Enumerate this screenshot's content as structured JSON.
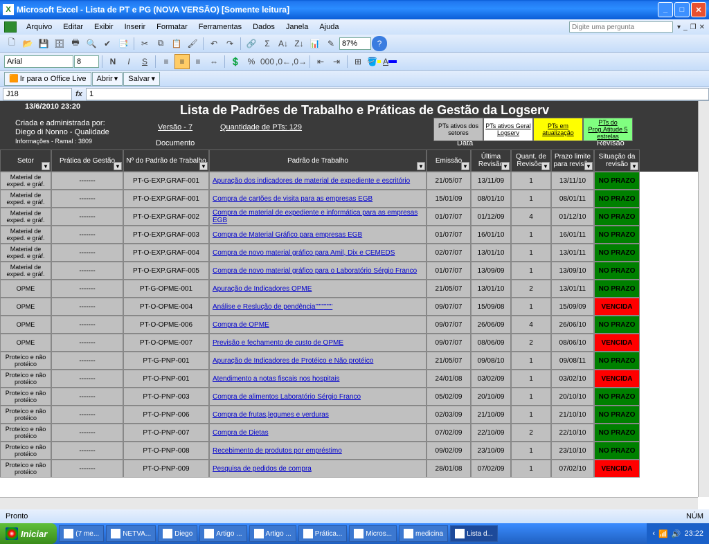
{
  "window": {
    "title": "Microsoft Excel - Lista de PT e PG (NOVA VERSÃO)  [Somente leitura]"
  },
  "menu": {
    "items": [
      "Arquivo",
      "Editar",
      "Exibir",
      "Inserir",
      "Formatar",
      "Ferramentas",
      "Dados",
      "Janela",
      "Ajuda"
    ],
    "ask_placeholder": "Digite uma pergunta"
  },
  "format": {
    "font_name": "Arial",
    "font_size": "8",
    "zoom": "87%"
  },
  "office_live": {
    "go": "Ir para o Office Live",
    "open": "Abrir",
    "save": "Salvar"
  },
  "formula": {
    "name_box": "J18",
    "fx": "fx",
    "value": "1"
  },
  "header": {
    "timestamp": "13/6/2010 23:20",
    "title": "Lista de Padrões de Trabalho e Práticas de Gestão da Logserv",
    "admin_line1": "Criada e administrada por:",
    "admin_line2": "Diego di Nonno  - Qualidade",
    "admin_line3": "Informações  - Ramal : 3809",
    "versao": "Versão - 7",
    "qtd_label": "Quantidade de PTs:",
    "qtd_value": "129",
    "documento": "Documento",
    "data": "Data",
    "revisao": "Revisão",
    "filters": {
      "setores": "PTs ativos dos setores",
      "geral": "PTs ativos Geral Logserv",
      "atual": "PTs em atualização",
      "atitude": "PTs do Prog.Atitude 5 estrelas"
    }
  },
  "columns": {
    "setor": "Setor",
    "pratica": "Prática de Gestão",
    "num": "Nº do Padrão de Trabalho",
    "padrao": "Padrão de Trabalho",
    "emissao": "Emissão",
    "ult_rev": "Última Revisão",
    "quant_rev": "Quant. de Revisões",
    "prazo": "Prazo limite para revisão",
    "sit": "Situação da revisão"
  },
  "rows": [
    {
      "setor": "Material de exped. e gráf.",
      "prat": "-------",
      "num": "PT-G-EXP.GRAF-001",
      "pad": "Apuração dos indicadores de material de expediente e escritório",
      "emis": "21/05/07",
      "urev": "13/11/09",
      "qrev": "1",
      "prazo": "13/11/10",
      "sit": "NO PRAZO",
      "ok": true
    },
    {
      "setor": "Material de exped. e gráf.",
      "prat": "-------",
      "num": "PT-O-EXP.GRAF-001",
      "pad": "Compra de cartões de visita para as empresas EGB",
      "emis": "15/01/09",
      "urev": "08/01/10",
      "qrev": "1",
      "prazo": "08/01/11",
      "sit": "NO PRAZO",
      "ok": true
    },
    {
      "setor": "Material de exped. e gráf.",
      "prat": "-------",
      "num": "PT-O-EXP.GRAF-002",
      "pad": "Compra de material de expediente e informática para as empresas EGB",
      "emis": "01/07/07",
      "urev": "01/12/09",
      "qrev": "4",
      "prazo": "01/12/10",
      "sit": "NO PRAZO",
      "ok": true
    },
    {
      "setor": "Material de exped. e gráf.",
      "prat": "-------",
      "num": "PT-O-EXP.GRAF-003",
      "pad": "Compra de Material Gráfico para empresas EGB",
      "emis": "01/07/07",
      "urev": "16/01/10",
      "qrev": "1",
      "prazo": "16/01/11",
      "sit": "NO PRAZO",
      "ok": true
    },
    {
      "setor": "Material de exped. e gráf.",
      "prat": "-------",
      "num": "PT-O-EXP.GRAF-004",
      "pad": "Compra de novo material gráfico para Amil, Dix e CEMEDS",
      "emis": "02/07/07",
      "urev": "13/01/10",
      "qrev": "1",
      "prazo": "13/01/11",
      "sit": "NO PRAZO",
      "ok": true
    },
    {
      "setor": "Material de exped. e gráf.",
      "prat": "-------",
      "num": "PT-O-EXP.GRAF-005",
      "pad": "Compra de novo material gráfico para o Laboratório Sérgio Franco",
      "emis": "01/07/07",
      "urev": "13/09/09",
      "qrev": "1",
      "prazo": "13/09/10",
      "sit": "NO PRAZO",
      "ok": true
    },
    {
      "setor": "OPME",
      "prat": "-------",
      "num": "PT-G-OPME-001",
      "pad": "Apuração de Indicadores OPME",
      "emis": "21/05/07",
      "urev": "13/01/10",
      "qrev": "2",
      "prazo": "13/01/11",
      "sit": "NO PRAZO",
      "ok": true
    },
    {
      "setor": "OPME",
      "prat": "-------",
      "num": "PT-O-OPME-004",
      "pad": "Análise e Reslução de pendência\"\"\"\"\"\"\"",
      "emis": "09/07/07",
      "urev": "15/09/08",
      "qrev": "1",
      "prazo": "15/09/09",
      "sit": "VENCIDA",
      "ok": false
    },
    {
      "setor": "OPME",
      "prat": "-------",
      "num": "PT-O-OPME-006",
      "pad": "Compra de OPME",
      "emis": "09/07/07",
      "urev": "26/06/09",
      "qrev": "4",
      "prazo": "26/06/10",
      "sit": "NO PRAZO",
      "ok": true
    },
    {
      "setor": "OPME",
      "prat": "-------",
      "num": "PT-O-OPME-007",
      "pad": "Previsão e fechamento de custo de OPME",
      "emis": "09/07/07",
      "urev": "08/06/09",
      "qrev": "2",
      "prazo": "08/06/10",
      "sit": "VENCIDA",
      "ok": false
    },
    {
      "setor": "Proteíco e não protéico",
      "prat": "-------",
      "num": "PT-G-PNP-001",
      "pad": "Apuração de Indicadores de Protéico e Não protéico",
      "emis": "21/05/07",
      "urev": "09/08/10",
      "qrev": "1",
      "prazo": "09/08/11",
      "sit": "NO PRAZO",
      "ok": true
    },
    {
      "setor": "Proteíco e não protéico",
      "prat": "-------",
      "num": "PT-O-PNP-001",
      "pad": "Atendimento a notas fiscais nos hospitais",
      "emis": "24/01/08",
      "urev": "03/02/09",
      "qrev": "1",
      "prazo": "03/02/10",
      "sit": "VENCIDA",
      "ok": false
    },
    {
      "setor": "Proteíco e não protéico",
      "prat": "-------",
      "num": "PT-O-PNP-003",
      "pad": "Compra de alimentos Laboratório Sérgio Franco",
      "emis": "05/02/09",
      "urev": "20/10/09",
      "qrev": "1",
      "prazo": "20/10/10",
      "sit": "NO PRAZO",
      "ok": true
    },
    {
      "setor": "Proteíco e não protéico",
      "prat": "-------",
      "num": "PT-O-PNP-006",
      "pad": "Compra de frutas,legumes e verduras",
      "emis": "02/03/09",
      "urev": "21/10/09",
      "qrev": "1",
      "prazo": "21/10/10",
      "sit": "NO PRAZO",
      "ok": true
    },
    {
      "setor": "Proteíco e não protéico",
      "prat": "-------",
      "num": "PT-O-PNP-007",
      "pad": "Compra de Dietas",
      "emis": "07/02/09",
      "urev": "22/10/09",
      "qrev": "2",
      "prazo": "22/10/10",
      "sit": "NO PRAZO",
      "ok": true
    },
    {
      "setor": "Proteíco e não protéico",
      "prat": "-------",
      "num": "PT-O-PNP-008",
      "pad": "Recebimento de produtos por empréstimo",
      "emis": "09/02/09",
      "urev": "23/10/09",
      "qrev": "1",
      "prazo": "23/10/10",
      "sit": "NO PRAZO",
      "ok": true
    },
    {
      "setor": "Proteíco e não protéico",
      "prat": "-------",
      "num": "PT-O-PNP-009",
      "pad": "Pesquisa de pedidos de compra",
      "emis": "28/01/08",
      "urev": "07/02/09",
      "qrev": "1",
      "prazo": "07/02/10",
      "sit": "VENCIDA",
      "ok": false
    }
  ],
  "statusbar": {
    "ready": "Pronto",
    "num": "NÚM"
  },
  "taskbar": {
    "start": "Iniciar",
    "tasks": [
      "(7 me...",
      "NETVA...",
      "Diego",
      "Artigo ...",
      "Artigo ...",
      "Prática...",
      "Micros...",
      "medicina",
      "Lista d..."
    ],
    "clock": "23:22"
  }
}
